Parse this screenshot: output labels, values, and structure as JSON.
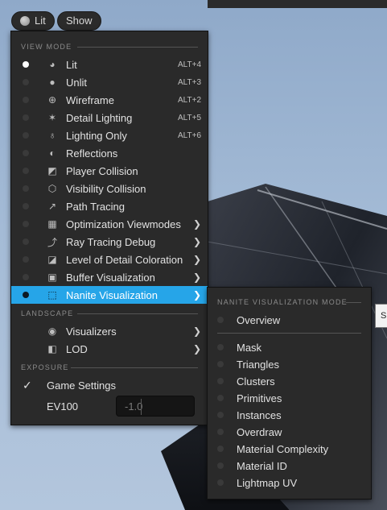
{
  "toolbar": {
    "lit_label": "Lit",
    "show_label": "Show"
  },
  "menu": {
    "sections": {
      "view_mode": "VIEW MODE",
      "landscape": "LANDSCAPE",
      "exposure": "EXPOSURE"
    },
    "view_items": [
      {
        "label": "Lit",
        "shortcut": "ALT+4",
        "icon": "sphere-lit-icon",
        "selected": true
      },
      {
        "label": "Unlit",
        "shortcut": "ALT+3",
        "icon": "sphere-unlit-icon"
      },
      {
        "label": "Wireframe",
        "shortcut": "ALT+2",
        "icon": "wireframe-globe-icon"
      },
      {
        "label": "Detail Lighting",
        "shortcut": "ALT+5",
        "icon": "detail-lighting-icon"
      },
      {
        "label": "Lighting Only",
        "shortcut": "ALT+6",
        "icon": "lightbulb-icon"
      },
      {
        "label": "Reflections",
        "icon": "reflections-icon"
      },
      {
        "label": "Player Collision",
        "icon": "player-collision-icon"
      },
      {
        "label": "Visibility Collision",
        "icon": "visibility-collision-icon"
      },
      {
        "label": "Path Tracing",
        "icon": "path-tracing-icon"
      },
      {
        "label": "Optimization Viewmodes",
        "icon": "optimization-grid-icon",
        "submenu": true
      },
      {
        "label": "Ray Tracing Debug",
        "icon": "ray-tracing-icon",
        "submenu": true
      },
      {
        "label": "Level of Detail Coloration",
        "icon": "lod-coloration-icon",
        "submenu": true
      },
      {
        "label": "Buffer Visualization",
        "icon": "buffer-icon",
        "submenu": true
      },
      {
        "label": "Nanite Visualization",
        "icon": "nanite-icon",
        "submenu": true,
        "active": true
      }
    ],
    "landscape_items": [
      {
        "label": "Visualizers",
        "icon": "eye-visualizers-icon",
        "submenu": true
      },
      {
        "label": "LOD",
        "icon": "lod-icon",
        "submenu": true
      }
    ],
    "exposure": {
      "game_settings_label": "Game Settings",
      "ev100_label": "EV100",
      "ev100_value": "-1.0"
    }
  },
  "nanite_menu": {
    "header": "NANITE VISUALIZATION MODE",
    "overview": "Overview",
    "items": [
      "Mask",
      "Triangles",
      "Clusters",
      "Primitives",
      "Instances",
      "Overdraw",
      "Material Complexity",
      "Material ID",
      "Lightmap UV"
    ]
  },
  "colors": {
    "accent": "#26a5e8",
    "menu_bg": "#2a2a2a"
  }
}
